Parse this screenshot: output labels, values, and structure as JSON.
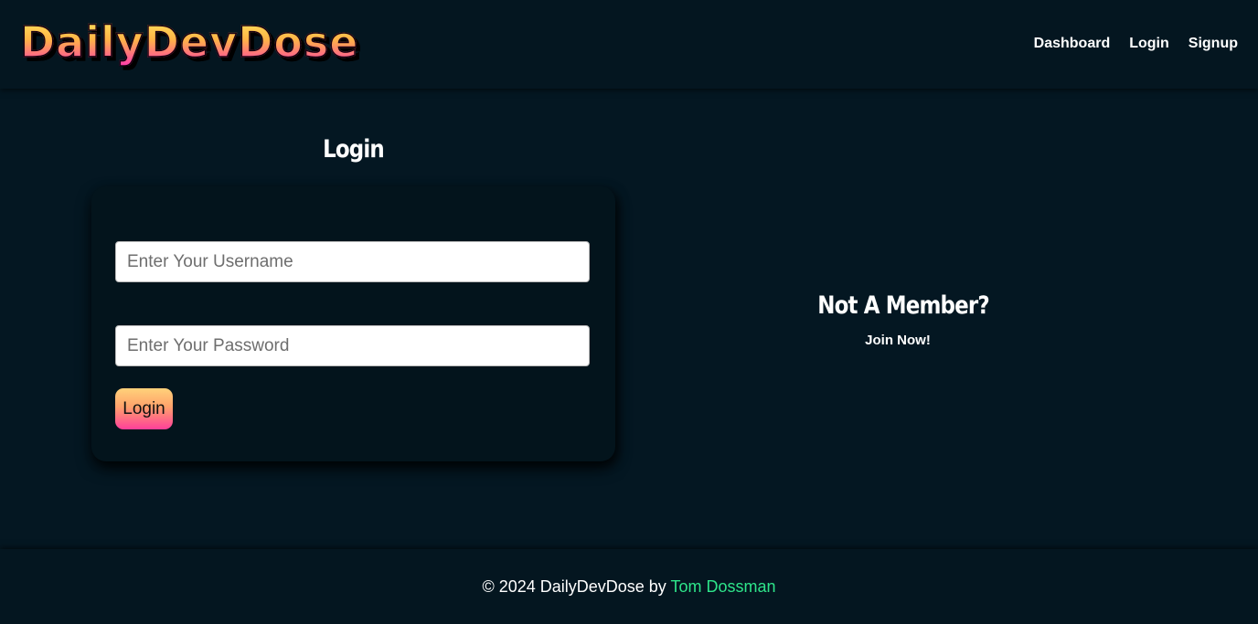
{
  "header": {
    "logo_text": "DailyDevDose",
    "nav": {
      "dashboard": "Dashboard",
      "login": "Login",
      "signup": "Signup"
    }
  },
  "login_form": {
    "title": "Login",
    "username_placeholder": "Enter Your Username",
    "username_value": "",
    "password_placeholder": "Enter Your Password",
    "password_value": "",
    "submit_label": "Login"
  },
  "signup_prompt": {
    "title": "Not A Member?",
    "link_label": "Join Now!"
  },
  "footer": {
    "copyright": "© 2024 DailyDevDose by",
    "author": "Tom Dossman"
  },
  "colors": {
    "background": "#041722",
    "author_link": "#2ee58a",
    "button_gradient_top": "#ffd27a",
    "button_gradient_bottom": "#ff3f9a"
  }
}
